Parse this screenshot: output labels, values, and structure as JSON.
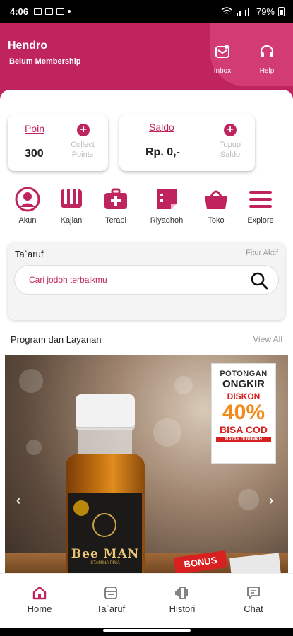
{
  "status_bar": {
    "time": "4:06",
    "battery": "79%"
  },
  "header": {
    "user_name": "Hendro",
    "membership": "Belum Membership",
    "inbox_label": "Inbox",
    "help_label": "Help"
  },
  "poin_card": {
    "title": "Poin",
    "value": "300",
    "action_line1": "Collect",
    "action_line2": "Points"
  },
  "saldo_card": {
    "title": "Saldo",
    "value": "Rp. 0,-",
    "action_line1": "Topup",
    "action_line2": "Saldo"
  },
  "menu": [
    {
      "label": "Akun",
      "icon": "account-icon"
    },
    {
      "label": "Kajian",
      "icon": "book-icon"
    },
    {
      "label": "Terapi",
      "icon": "medical-kit-icon"
    },
    {
      "label": "Riyadhoh",
      "icon": "notes-icon"
    },
    {
      "label": "Toko",
      "icon": "basket-icon"
    },
    {
      "label": "Explore",
      "icon": "menu-icon"
    }
  ],
  "taaruf": {
    "title": "Ta`aruf",
    "status": "Fitur Aktif",
    "search_placeholder": "Cari jodoh terbaikmu"
  },
  "programs": {
    "title": "Program dan Layanan",
    "view_all": "View All"
  },
  "banner": {
    "promo_line1": "POTONGAN",
    "promo_line2": "ONGKIR",
    "promo_line3": "DISKON",
    "promo_line4": "40%",
    "promo_line5": "BISA COD",
    "promo_line6": "BAYAR DI RUMAH",
    "product_brand": "Bee MAN",
    "product_sub": "STAMINA PRIA",
    "bonus": "BONUS"
  },
  "bottom_nav": [
    {
      "label": "Home",
      "icon": "home-icon"
    },
    {
      "label": "Ta`aruf",
      "icon": "taaruf-icon"
    },
    {
      "label": "Histori",
      "icon": "history-icon"
    },
    {
      "label": "Chat",
      "icon": "chat-icon"
    }
  ],
  "colors": {
    "primary": "#c0245f",
    "primary_light": "#d23b73"
  }
}
